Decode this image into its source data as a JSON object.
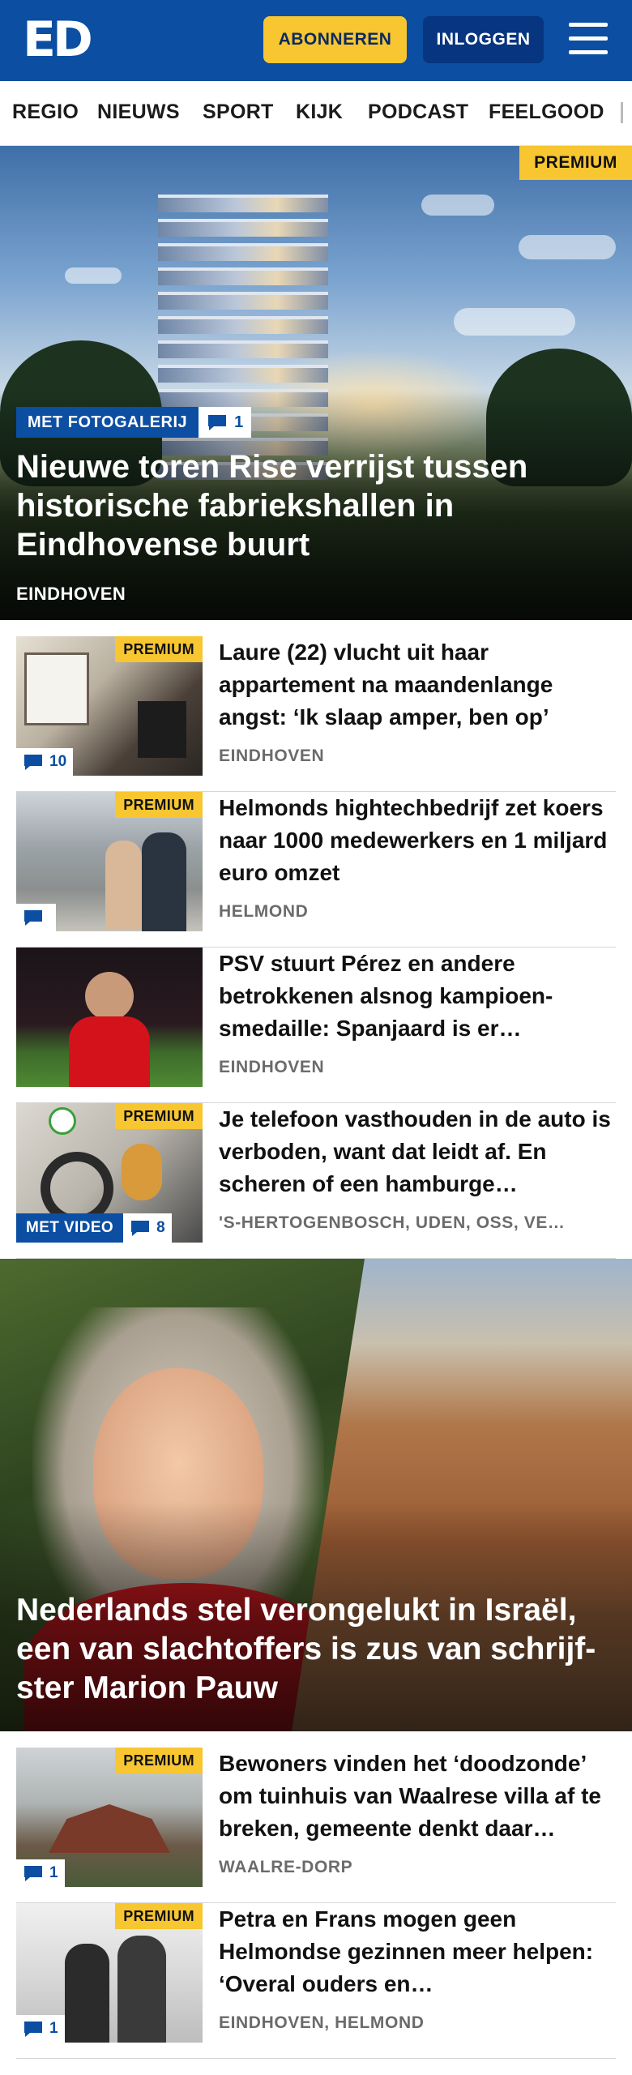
{
  "header": {
    "logo": "ED",
    "subscribe_label": "ABONNEREN",
    "login_label": "INLOGGEN"
  },
  "nav": {
    "items": [
      "REGIO",
      "NIEUWS",
      "SPORT",
      "KIJK",
      "PODCAST",
      "FEELGOOD"
    ]
  },
  "hero": {
    "premium": "PREMIUM",
    "tag": "MET FOTOGALERIJ",
    "comments": "1",
    "title": "Nieuwe toren Rise verrijst tussen historische fabriekshallen in Eindhovense buurt",
    "location": "EINDHOVEN"
  },
  "articles": [
    {
      "premium": "PREMIUM",
      "comments": "10",
      "title": "Laure (22) vlucht uit haar appartement na maandenlange angst: ‘Ik slaap amper, ben op’",
      "location": "EINDHOVEN"
    },
    {
      "premium": "PREMIUM",
      "comments": "",
      "title": "Helmonds hightechbedrijf zet koers naar 1000 medewerkers en 1 miljard euro omzet",
      "location": "HELMOND"
    },
    {
      "title": "PSV stuurt Pérez en andere betrokkenen alsnog kampioen-smedaille: Spanjaard is er…",
      "location": "EINDHOVEN"
    },
    {
      "premium": "PREMIUM",
      "video": "MET VIDEO",
      "comments": "8",
      "title": "Je telefoon vasthouden in de auto is verboden, want dat leidt af. En scheren of een hamburge…",
      "location": "'S-HERTOGENBOSCH, UDEN, OSS, VE…"
    }
  ],
  "hero2": {
    "title": "Nederlands stel verongelukt in Israël, een van slachtoffers is zus van schrijf-ster Marion Pauw"
  },
  "articles2": [
    {
      "premium": "PREMIUM",
      "comments": "1",
      "title": "Bewoners vinden het ‘doodzonde’ om tuinhuis van Waalrese villa af te breken, gemeente denkt daar…",
      "location": "WAALRE-DORP"
    },
    {
      "premium": "PREMIUM",
      "comments": "1",
      "title": "Petra en Frans mogen geen Helmondse gezinnen meer helpen: ‘Overal ouders en…",
      "location": "EINDHOVEN, HELMOND"
    }
  ],
  "colors": {
    "brand_blue": "#0b4ea2",
    "premium_yellow": "#f7c631",
    "login_blue": "#073580"
  }
}
